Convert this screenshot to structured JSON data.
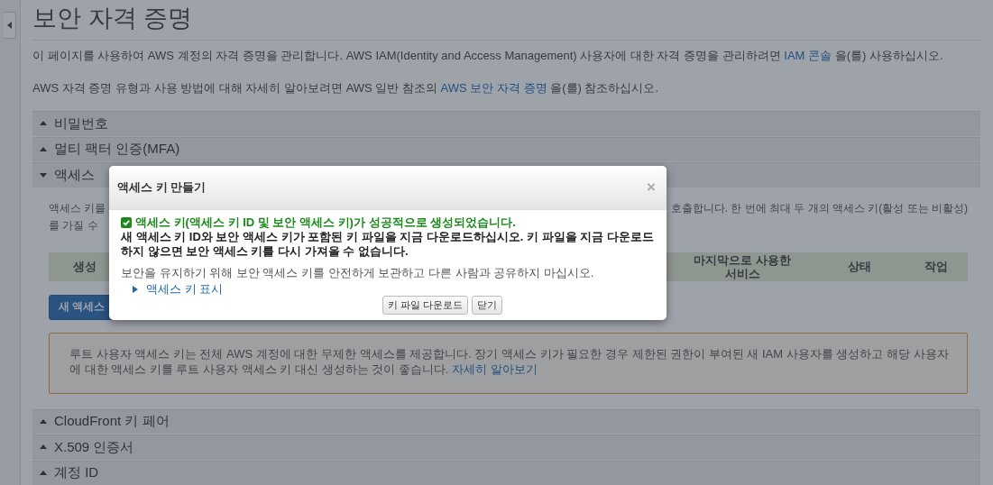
{
  "page": {
    "title": "보안 자격 증명",
    "intro": [
      {
        "before": "이 페이지를 사용하여 AWS 계정의 자격 증명을 관리합니다. AWS IAM(Identity and Access Management) 사용자에 대한 자격 증명을 관리하려면 ",
        "link": "IAM 콘솔",
        "after": " 을(를) 사용하십시오."
      },
      {
        "before": "AWS 자격 증명 유형과 사용 방법에 대해 자세히 알아보려면 AWS 일반 참조의 ",
        "link": "AWS 보안 자격 증명",
        "after": " 을(를) 참조하십시오."
      }
    ],
    "sections": [
      {
        "title": "비밀번호",
        "expanded": false
      },
      {
        "title": "멀티 팩터 인증(MFA)",
        "expanded": false
      },
      {
        "title": "액세스",
        "expanded": true
      },
      {
        "title": "CloudFront 키 페어",
        "expanded": false
      },
      {
        "title": "X.509 인증서",
        "expanded": false
      },
      {
        "title": "계정 ID",
        "expanded": false
      }
    ],
    "access_keys": {
      "description_left": [
        "액세스 키를",
        "를 가질 수"
      ],
      "description_right": "호출합니다. 한 번에 최대 두 개의 액세스 키(활성 또는 비활성)",
      "columns": [
        "생성",
        "마지막으로 사용한 서비스",
        "상태",
        "작업"
      ],
      "button": "새 액세스",
      "warning": {
        "text": "루트 사용자 액세스 키는 전체 AWS 계정에 대한 무제한 액세스를 제공합니다. 장기 액세스 키가 필요한 경우 제한된 권한이 부여된 새 IAM 사용자를 생성하고 해당 사용자에 대한 액세스 키를 루트 사용자 액세스 키 대신 생성하는 것이 좋습니다. ",
        "link": "자세히 알아보기"
      }
    }
  },
  "modal": {
    "title": "액세스 키 만들기",
    "close": "×",
    "success": "액세스 키(액세스 키 ID 및 보안 액세스 키)가 성공적으로 생성되었습니다.",
    "warning": "새 액세스 키 ID와 보안 액세스 키가 포함된 키 파일을 지금 다운로드하십시오. 키 파일을 지금 다운로드하지 않으면 보안 액세스 키를 다시 가져올 수 없습니다.",
    "info": "보안을 유지하기 위해 보안 액세스 키를 안전하게 보관하고 다른 사람과 공유하지 마십시오.",
    "show_keys": {
      "label": "액세스 키 표시",
      "expanded": false
    },
    "buttons": [
      "키 파일 다운로드",
      "닫기"
    ]
  }
}
